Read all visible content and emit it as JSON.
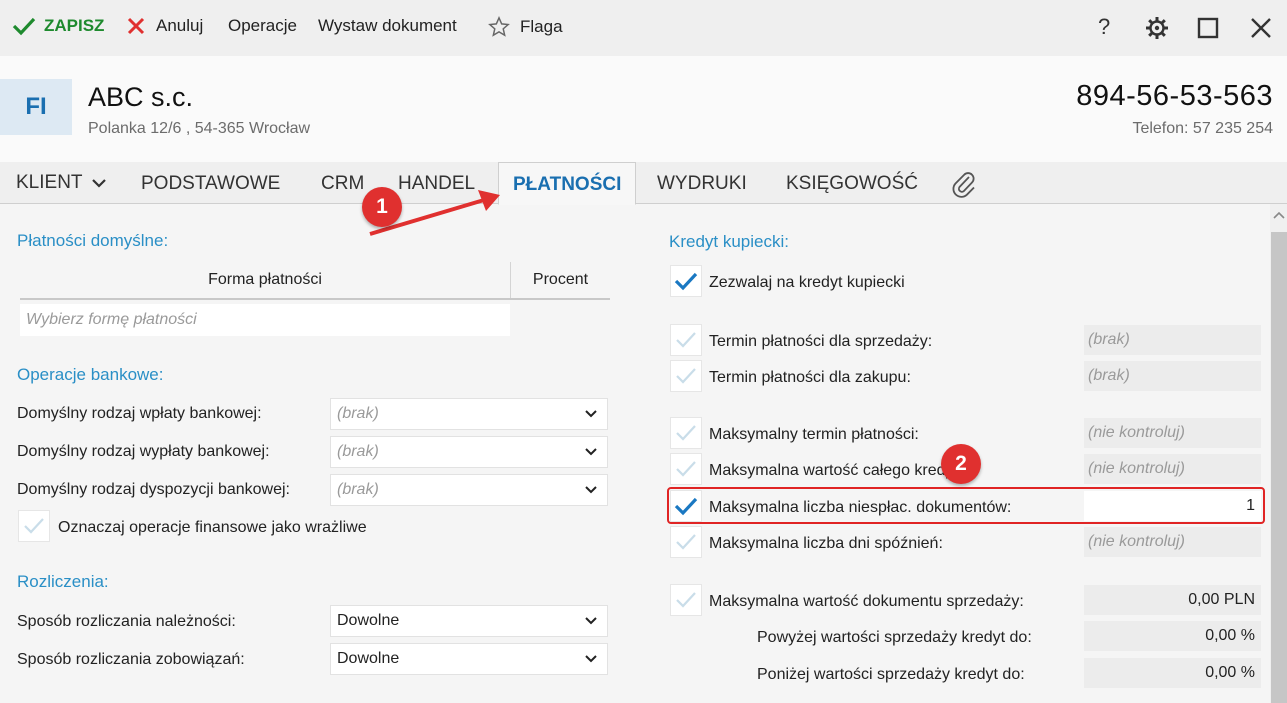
{
  "toolbar": {
    "save_label": "ZAPISZ",
    "cancel_label": "Anuluj",
    "operations_label": "Operacje",
    "issue_document_label": "Wystaw dokument",
    "flag_label": "Flaga",
    "help_label": "?"
  },
  "header": {
    "badge": "FI",
    "company_name": "ABC s.c.",
    "address": "Polanka  12/6 , 54-365 Wrocław",
    "nip": "894-56-53-563",
    "phone": "Telefon: 57 235 254"
  },
  "tabs": [
    {
      "label": "KLIENT"
    },
    {
      "label": "PODSTAWOWE"
    },
    {
      "label": "CRM"
    },
    {
      "label": "HANDEL"
    },
    {
      "label": "PŁATNOŚCI"
    },
    {
      "label": "WYDRUKI"
    },
    {
      "label": "KSIĘGOWOŚĆ"
    }
  ],
  "default_payments": {
    "title": "Płatności domyślne:",
    "col_form": "Forma płatności",
    "col_percent": "Procent",
    "input_placeholder": "Wybierz formę płatności"
  },
  "bank_ops": {
    "title": "Operacje bankowe:",
    "rows": [
      {
        "label": "Domyślny rodzaj wpłaty bankowej:",
        "value": "(brak)"
      },
      {
        "label": "Domyślny rodzaj wypłaty bankowej:",
        "value": "(brak)"
      },
      {
        "label": "Domyślny rodzaj dyspozycji bankowej:",
        "value": "(brak)"
      }
    ],
    "sensitive_label": "Oznaczaj operacje finansowe jako wrażliwe"
  },
  "settlements": {
    "title": "Rozliczenia:",
    "rows": [
      {
        "label": "Sposób rozliczania należności:",
        "value": "Dowolne"
      },
      {
        "label": "Sposób rozliczania zobowiązań:",
        "value": "Dowolne"
      }
    ]
  },
  "credit": {
    "title": "Kredyt kupiecki:",
    "allow_label": "Zezwalaj na kredyt kupiecki",
    "rows": [
      {
        "label": "Termin płatności dla sprzedaży:",
        "value": "(brak)",
        "checked": false
      },
      {
        "label": "Termin płatności dla zakupu:",
        "value": "(brak)",
        "checked": false
      },
      {
        "label": "Maksymalny termin płatności:",
        "value": "(nie kontroluj)",
        "checked": false
      },
      {
        "label": "Maksymalna wartość całego kredytu:",
        "value": "(nie kontroluj)",
        "checked": false
      },
      {
        "label": "Maksymalna liczba niespłac. dokumentów:",
        "value": "1",
        "checked": true
      },
      {
        "label": "Maksymalna liczba dni spóźnień:",
        "value": "(nie kontroluj)",
        "checked": false
      },
      {
        "label": "Maksymalna wartość dokumentu sprzedaży:",
        "value": "0,00 PLN",
        "checked": false
      }
    ],
    "above_label": "Powyżej wartości sprzedaży kredyt do:",
    "above_value": "0,00 %",
    "below_label": "Poniżej wartości sprzedaży kredyt do:",
    "below_value": "0,00 %"
  },
  "annotations": {
    "marker_1": "1",
    "marker_2": "2"
  },
  "colors": {
    "accent": "#1a6fb0",
    "section_title": "#2a8fc6",
    "save_green": "#1e8a2e",
    "annotation_red": "#e0302f"
  }
}
